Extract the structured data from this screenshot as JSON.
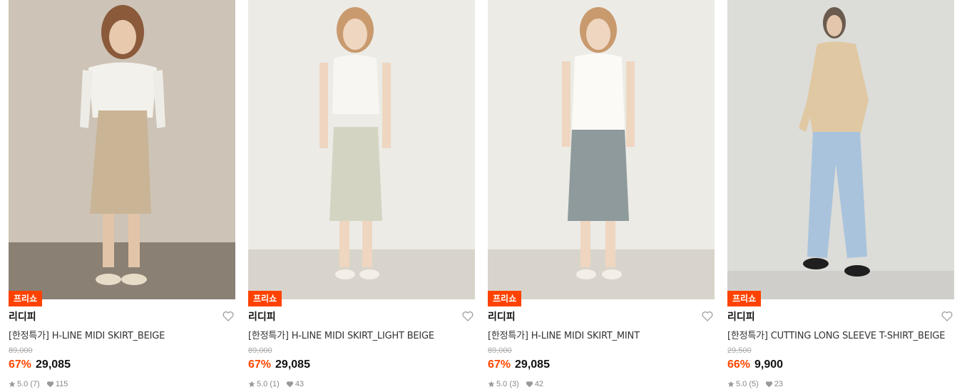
{
  "products": [
    {
      "badge": "프리쇼",
      "brand": "리디피",
      "name": "[한정특가] H-LINE MIDI SKIRT_BEIGE",
      "original_price": "89,000",
      "discount": "67%",
      "price": "29,085",
      "rating": "5.0",
      "reviews": "(7)",
      "likes": "115",
      "icons": {
        "star": "star-icon",
        "like": "heart-icon",
        "wishlist": "heart-outline-icon"
      }
    },
    {
      "badge": "프리쇼",
      "brand": "리디피",
      "name": "[한정특가] H-LINE MIDI SKIRT_LIGHT BEIGE",
      "original_price": "89,000",
      "discount": "67%",
      "price": "29,085",
      "rating": "5.0",
      "reviews": "(1)",
      "likes": "43",
      "icons": {
        "star": "star-icon",
        "like": "heart-icon",
        "wishlist": "heart-outline-icon"
      }
    },
    {
      "badge": "프리쇼",
      "brand": "리디피",
      "name": "[한정특가] H-LINE MIDI SKIRT_MINT",
      "original_price": "89,000",
      "discount": "67%",
      "price": "29,085",
      "rating": "5.0",
      "reviews": "(3)",
      "likes": "42",
      "icons": {
        "star": "star-icon",
        "like": "heart-icon",
        "wishlist": "heart-outline-icon"
      }
    },
    {
      "badge": "프리쇼",
      "brand": "리디피",
      "name": "[한정특가] CUTTING LONG SLEEVE T-SHIRT_BEIGE",
      "original_price": "29,500",
      "discount": "66%",
      "price": "9,900",
      "rating": "5.0",
      "reviews": "(5)",
      "likes": "23",
      "icons": {
        "star": "star-icon",
        "like": "heart-icon",
        "wishlist": "heart-outline-icon"
      }
    }
  ],
  "colors": {
    "badge_bg": "#ff4200",
    "discount": "#ff4800",
    "photo1_bg": "#cfc6bb",
    "photo1_skirt": "#c9b596",
    "photo2_skirt": "#d3d5c2",
    "photo3_skirt": "#8e9a9b",
    "photo4_jeans": "#a9c3dc"
  }
}
